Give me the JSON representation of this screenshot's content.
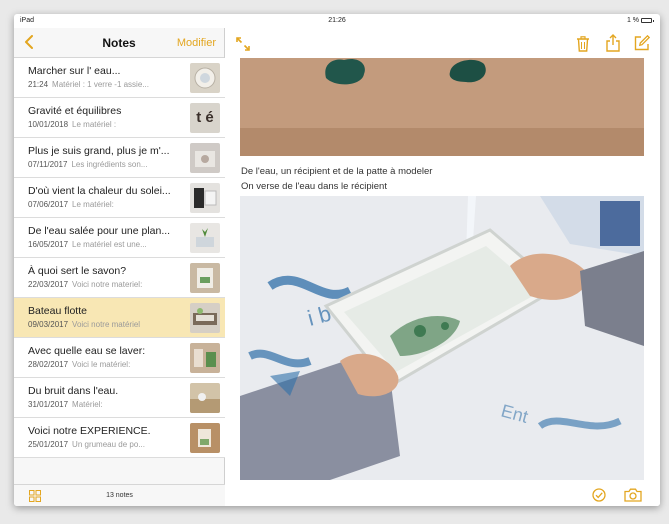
{
  "status": {
    "device": "iPad",
    "time": "21:26",
    "battery": "1 %"
  },
  "sidebar": {
    "title": "Notes",
    "edit_label": "Modifier",
    "notes": [
      {
        "title": "Marcher sur l' eau...",
        "date": "21:24",
        "preview": "Matériel : 1 verre -1 assie..."
      },
      {
        "title": "Gravité et équilibres",
        "date": "10/01/2018",
        "preview": "Le matériel :"
      },
      {
        "title": "Plus je suis grand, plus je m'...",
        "date": "07/11/2017",
        "preview": "Les ingrédients son..."
      },
      {
        "title": "D'où vient la chaleur du solei...",
        "date": "07/06/2017",
        "preview": "Le matériel:"
      },
      {
        "title": "De l'eau salée pour une plan...",
        "date": "16/05/2017",
        "preview": "Le matériel est une..."
      },
      {
        "title": "À quoi sert le savon?",
        "date": "22/03/2017",
        "preview": "Voici notre materiel:"
      },
      {
        "title": "Bateau flotte",
        "date": "09/03/2017",
        "preview": "Voici notre matériel"
      },
      {
        "title": "Avec quelle eau se laver:",
        "date": "28/02/2017",
        "preview": "Voici le matériel:"
      },
      {
        "title": "Du bruit dans l'eau.",
        "date": "31/01/2017",
        "preview": "Matériel:"
      },
      {
        "title": "Voici notre EXPERIENCE.",
        "date": "25/01/2017",
        "preview": "Un grumeau de po..."
      }
    ],
    "thumb_text_1": "t é",
    "count_label": "13 notes"
  },
  "detail": {
    "line1": "De l'eau, un récipient et de la patte à modeler",
    "line2": "On verse de l'eau dans le récipient"
  },
  "colors": {
    "accent": "#e3a620",
    "selected_row": "#f8e7b4"
  },
  "icons": [
    "back-chevron-icon",
    "grid-icon",
    "expand-icon",
    "trash-icon",
    "share-icon",
    "compose-icon",
    "checklist-icon",
    "camera-icon"
  ]
}
